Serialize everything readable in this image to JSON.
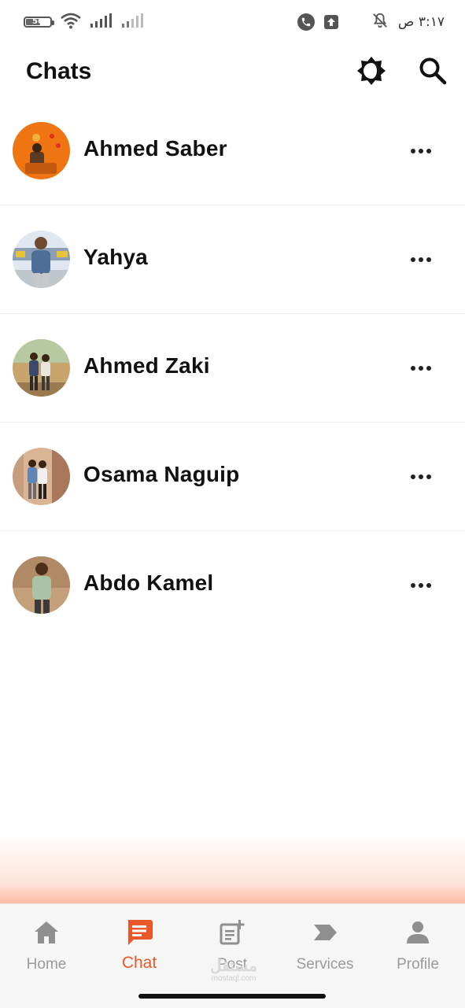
{
  "status_bar": {
    "battery": "56",
    "battery_level": 0.56,
    "time": "٣:١٧ ص",
    "icons": [
      "battery-icon",
      "wifi-icon",
      "signal-icon",
      "signal-weak-icon",
      "call-icon",
      "upload-icon",
      "mute-icon"
    ]
  },
  "header": {
    "title": "Chats",
    "icons": [
      "theme-toggle-icon",
      "search-icon"
    ]
  },
  "chats": [
    {
      "name": "Ahmed Saber",
      "avatar_colors": [
        "#f07a10",
        "#e86510"
      ]
    },
    {
      "name": "Yahya",
      "avatar_colors": [
        "#c9d8ea",
        "#6d7f95"
      ]
    },
    {
      "name": "Ahmed Zaki",
      "avatar_colors": [
        "#c9a876",
        "#8a6b42"
      ]
    },
    {
      "name": "Osama Naguip",
      "avatar_colors": [
        "#d8b090",
        "#a67a58"
      ]
    },
    {
      "name": "Abdo Kamel",
      "avatar_colors": [
        "#c2a07c",
        "#6e5038"
      ]
    }
  ],
  "bottom_nav": {
    "items": [
      {
        "label": "Home",
        "icon": "home-icon",
        "active": false
      },
      {
        "label": "Chat",
        "icon": "chat-icon",
        "active": true
      },
      {
        "label": "Post",
        "icon": "post-add-icon",
        "active": false
      },
      {
        "label": "Services",
        "icon": "services-icon",
        "active": false
      },
      {
        "label": "Profile",
        "icon": "profile-icon",
        "active": false
      }
    ]
  },
  "watermark": {
    "arabic": "مستقل",
    "latin": "mostaql.com"
  },
  "colors": {
    "accent": "#e8582a",
    "inactive": "#9a9a9a",
    "text": "#111111"
  }
}
